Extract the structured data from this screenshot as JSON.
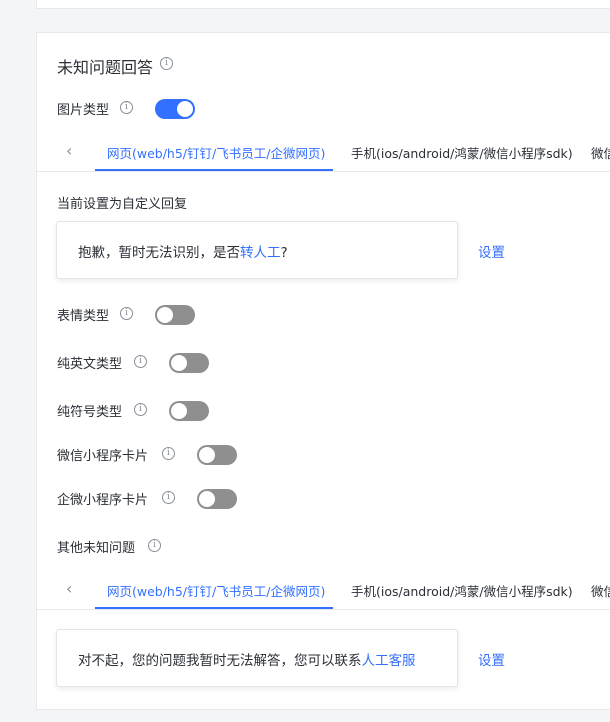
{
  "section": {
    "title": "未知问题回答"
  },
  "image_type": {
    "label": "图片类型",
    "enabled": true
  },
  "tabs1": {
    "items": [
      "网页(web/h5/钉钉/飞书员工/企微网页)",
      "手机(ios/android/鸿蒙/微信小程序sdk)",
      "微信"
    ],
    "active_index": 0
  },
  "current_setting_label": "当前设置为自定义回复",
  "reply1": {
    "text_prefix": "抱歉，暂时无法识别，是否",
    "link_text": "转人工",
    "text_suffix": "?"
  },
  "set_label_1": "设置",
  "toggles": [
    {
      "label": "表情类型",
      "enabled": false
    },
    {
      "label": "纯英文类型",
      "enabled": false
    },
    {
      "label": "纯符号类型",
      "enabled": false
    },
    {
      "label": "微信小程序卡片",
      "enabled": false
    },
    {
      "label": "企微小程序卡片",
      "enabled": false
    }
  ],
  "other_unknown": {
    "label": "其他未知问题"
  },
  "tabs2": {
    "items": [
      "网页(web/h5/钉钉/飞书员工/企微网页)",
      "手机(ios/android/鸿蒙/微信小程序sdk)",
      "微信"
    ],
    "active_index": 0
  },
  "reply2": {
    "text_prefix": "对不起，您的问题我暂时无法解答，您可以联系",
    "link_text": "人工客服"
  },
  "set_label_2": "设置",
  "colors": {
    "accent": "#3370ff",
    "toggle_off": "#8f8f8f",
    "text": "#2b2f36"
  },
  "icons": {
    "info": "info-circle-icon",
    "tab_prev": "chevron-left-icon"
  }
}
